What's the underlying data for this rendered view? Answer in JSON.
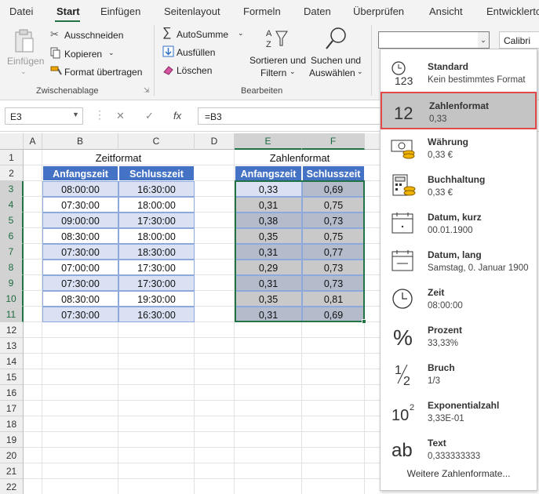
{
  "tabs": [
    "Datei",
    "Start",
    "Einfügen",
    "Seitenlayout",
    "Formeln",
    "Daten",
    "Überprüfen",
    "Ansicht",
    "Entwicklerto"
  ],
  "clipboard": {
    "paste": "Einfügen",
    "cut": "Ausschneiden",
    "copy": "Kopieren",
    "format_painter": "Format übertragen",
    "group": "Zwischenablage"
  },
  "editing": {
    "autosum": "AutoSumme",
    "fill": "Ausfüllen",
    "clear": "Löschen",
    "sort1": "Sortieren und",
    "sort2": "Filtern",
    "find1": "Suchen und",
    "find2": "Auswählen",
    "group": "Bearbeiten"
  },
  "font_box": "Calibri",
  "formula_bar": {
    "name_box": "E3",
    "fx": "fx",
    "formula": "=B3"
  },
  "columns": [
    "A",
    "B",
    "C",
    "D",
    "E",
    "F"
  ],
  "rows": [
    "1",
    "2",
    "3",
    "4",
    "5",
    "6",
    "7",
    "8",
    "9",
    "10",
    "11",
    "12",
    "13",
    "14",
    "15",
    "16",
    "17",
    "18",
    "19",
    "20",
    "21",
    "22"
  ],
  "sheet": {
    "zeit_title": "Zeitformat",
    "zahl_title": "Zahlenformat",
    "h_start": "Anfangszeit",
    "h_end": "Schlusszeit",
    "time_rows": [
      [
        "08:00:00",
        "16:30:00"
      ],
      [
        "07:30:00",
        "18:00:00"
      ],
      [
        "09:00:00",
        "17:30:00"
      ],
      [
        "08:30:00",
        "18:00:00"
      ],
      [
        "07:30:00",
        "18:30:00"
      ],
      [
        "07:00:00",
        "17:30:00"
      ],
      [
        "07:30:00",
        "17:30:00"
      ],
      [
        "08:30:00",
        "19:30:00"
      ],
      [
        "07:30:00",
        "16:30:00"
      ]
    ],
    "num_rows": [
      [
        "0,33",
        "0,69"
      ],
      [
        "0,31",
        "0,75"
      ],
      [
        "0,38",
        "0,73"
      ],
      [
        "0,35",
        "0,75"
      ],
      [
        "0,31",
        "0,77"
      ],
      [
        "0,29",
        "0,73"
      ],
      [
        "0,31",
        "0,73"
      ],
      [
        "0,35",
        "0,81"
      ],
      [
        "0,31",
        "0,69"
      ]
    ]
  },
  "number_formats": [
    {
      "icon": "clock-123-icon",
      "name": "Standard",
      "sample": "Kein bestimmtes Format"
    },
    {
      "icon": "number-12-icon",
      "name": "Zahlenformat",
      "sample": "0,33"
    },
    {
      "icon": "currency-icon",
      "name": "Währung",
      "sample": "0,33 €"
    },
    {
      "icon": "accounting-icon",
      "name": "Buchhaltung",
      "sample": " 0,33 €"
    },
    {
      "icon": "calendar-short-icon",
      "name": "Datum, kurz",
      "sample": "00.01.1900"
    },
    {
      "icon": "calendar-long-icon",
      "name": "Datum, lang",
      "sample": "Samstag, 0. Januar 1900"
    },
    {
      "icon": "clock-icon",
      "name": "Zeit",
      "sample": "08:00:00"
    },
    {
      "icon": "percent-icon",
      "name": "Prozent",
      "sample": "33,33%"
    },
    {
      "icon": "fraction-icon",
      "name": "Bruch",
      "sample": " 1/3"
    },
    {
      "icon": "exponent-icon",
      "name": "Exponentialzahl",
      "sample": "3,33E-01"
    },
    {
      "icon": "text-ab-icon",
      "name": "Text",
      "sample": "0,333333333"
    }
  ],
  "more_formats": "Weitere Zahlenformate...",
  "glyphs": {
    "twelve": "12",
    "percent": "%",
    "ten": "10",
    "two": "2",
    "ab": "ab",
    "one": "1",
    "slash": "⁄",
    "digits": "123",
    "dropdown": "⌄"
  }
}
